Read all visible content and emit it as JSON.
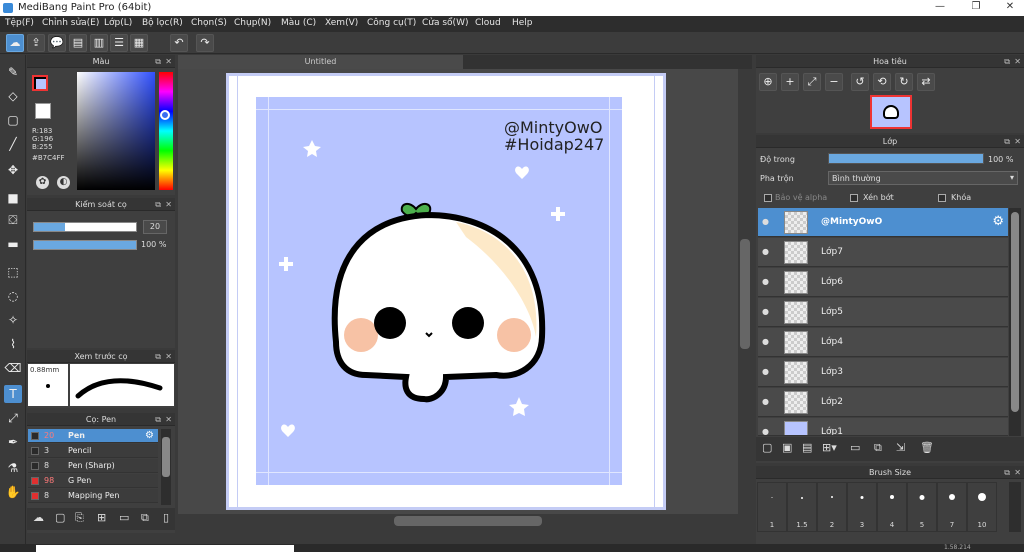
{
  "app": {
    "title": "MediBang Paint Pro (64bit)"
  },
  "window_controls": {
    "minimize": "—",
    "maximize": "❐",
    "close": "✕"
  },
  "menu": [
    "Tệp(F)",
    "Chỉnh sửa(E)",
    "Lớp(L)",
    "Bộ lọc(R)",
    "Chọn(S)",
    "Chụp(N)",
    "Màu (C)",
    "Xem(V)",
    "Công cụ(T)",
    "Cửa sổ(W)",
    "Cloud",
    "Help"
  ],
  "color_panel": {
    "title": "Màu",
    "r": "R:183",
    "g": "G:196",
    "b": "B:255",
    "hex": "#B7C4FF",
    "accent": "#B7C4FF"
  },
  "brush_control": {
    "title": "Kiểm soát cọ",
    "size_value": "20",
    "size_fill": 0.3,
    "opacity_value": "100 %",
    "opacity_fill": 1.0
  },
  "brush_preview": {
    "title": "Xem trước cọ",
    "size_label": "0.88mm"
  },
  "brush_list": {
    "title": "Cọ: Pen",
    "items": [
      {
        "size": "20",
        "name": "Pen",
        "color": "#2a2a2a",
        "selected": true
      },
      {
        "size": "3",
        "name": "Pencil",
        "color": "#2a2a2a",
        "selected": false
      },
      {
        "size": "8",
        "name": "Pen (Sharp)",
        "color": "#2a2a2a",
        "selected": false
      },
      {
        "size": "98",
        "name": "G Pen",
        "color": "#e03030",
        "selected": false
      },
      {
        "size": "8",
        "name": "Mapping Pen",
        "color": "#e03030",
        "selected": false
      }
    ]
  },
  "canvas": {
    "tab_title": "Untitled",
    "watermark_line1": "@MintyOwO",
    "watermark_line2": "#Hoidap247",
    "bg_color": "#B7C4FF"
  },
  "navigator": {
    "title": "Hoa tiêu"
  },
  "layer_panel": {
    "title": "Lớp",
    "opacity_label": "Độ trong",
    "opacity_value": "100 %",
    "opacity_fill": 1.0,
    "blend_label": "Pha trộn",
    "blend_value": "Bình thường",
    "protect_alpha": "Bảo vệ alpha",
    "clipping": "Xén bớt",
    "lock": "Khóa",
    "layers": [
      "@MintyOwO",
      "Lớp7",
      "Lớp6",
      "Lớp5",
      "Lớp4",
      "Lớp3",
      "Lớp2",
      "Lớp1"
    ]
  },
  "brush_size_panel": {
    "title": "Brush Size",
    "sizes": [
      "1",
      "1.5",
      "2",
      "3",
      "4",
      "5",
      "7",
      "10"
    ]
  },
  "status": {
    "coords": "1.58.214"
  }
}
